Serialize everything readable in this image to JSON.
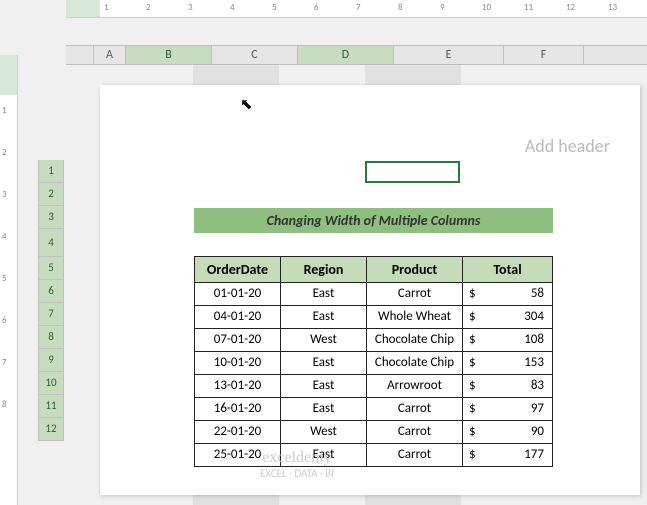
{
  "columns": [
    "A",
    "B",
    "C",
    "D",
    "E",
    "F"
  ],
  "rows": [
    "1",
    "2",
    "3",
    "4",
    "5",
    "6",
    "7",
    "8",
    "9",
    "10",
    "11",
    "12"
  ],
  "header_placeholder": "Add header",
  "title": "Changing Width of Multiple Columns",
  "tbl": {
    "headers": {
      "c0": "OrderDate",
      "c1": "Region",
      "c2": "Product",
      "c3": "Total"
    },
    "r0": {
      "date": "01-01-20",
      "region": "East",
      "product": "Carrot",
      "cur": "$",
      "amt": "58"
    },
    "r1": {
      "date": "04-01-20",
      "region": "East",
      "product": "Whole Wheat",
      "cur": "$",
      "amt": "304"
    },
    "r2": {
      "date": "07-01-20",
      "region": "West",
      "product": "Chocolate Chip",
      "cur": "$",
      "amt": "108"
    },
    "r3": {
      "date": "10-01-20",
      "region": "East",
      "product": "Chocolate Chip",
      "cur": "$",
      "amt": "153"
    },
    "r4": {
      "date": "13-01-20",
      "region": "East",
      "product": "Arrowroot",
      "cur": "$",
      "amt": "83"
    },
    "r5": {
      "date": "16-01-20",
      "region": "East",
      "product": "Carrot",
      "cur": "$",
      "amt": "97"
    },
    "r6": {
      "date": "22-01-20",
      "region": "West",
      "product": "Carrot",
      "cur": "$",
      "amt": "90"
    },
    "r7": {
      "date": "25-01-20",
      "region": "East",
      "product": "Carrot",
      "cur": "$",
      "amt": "177"
    }
  },
  "ruler_h": [
    "1",
    "2",
    "3",
    "4",
    "5",
    "6",
    "7",
    "8",
    "9",
    "10",
    "11",
    "12",
    "13"
  ],
  "ruler_v": [
    "1",
    "2",
    "3",
    "4",
    "5",
    "6",
    "7",
    "8"
  ],
  "watermark": {
    "line1": "exceldemy",
    "line2": "EXCEL · DATA · BI"
  },
  "chart_data": {
    "type": "table",
    "title": "Changing Width of Multiple Columns",
    "columns": [
      "OrderDate",
      "Region",
      "Product",
      "Total"
    ],
    "rows": [
      [
        "01-01-20",
        "East",
        "Carrot",
        58
      ],
      [
        "04-01-20",
        "East",
        "Whole Wheat",
        304
      ],
      [
        "07-01-20",
        "West",
        "Chocolate Chip",
        108
      ],
      [
        "10-01-20",
        "East",
        "Chocolate Chip",
        153
      ],
      [
        "13-01-20",
        "East",
        "Arrowroot",
        83
      ],
      [
        "16-01-20",
        "East",
        "Carrot",
        97
      ],
      [
        "22-01-20",
        "West",
        "Carrot",
        90
      ],
      [
        "25-01-20",
        "East",
        "Carrot",
        177
      ]
    ]
  }
}
